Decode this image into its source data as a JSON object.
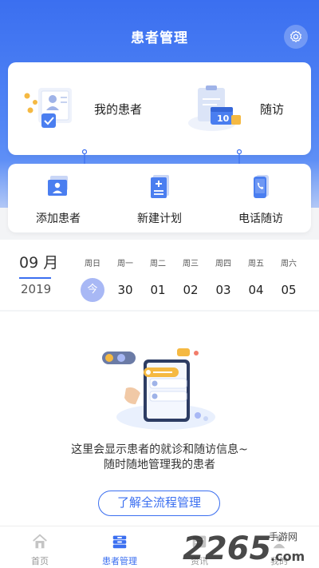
{
  "header": {
    "title": "患者管理",
    "settings_icon": "gear-icon",
    "bg_color": "#3b6ff0"
  },
  "quick_top": [
    {
      "label": "我的患者",
      "icon": "patient-card-icon"
    },
    {
      "label": "随访",
      "icon": "calendar-clipboard-icon"
    }
  ],
  "quick_bottom": [
    {
      "label": "添加患者",
      "icon": "add-patient-icon"
    },
    {
      "label": "新建计划",
      "icon": "new-plan-icon"
    },
    {
      "label": "电话随访",
      "icon": "phone-icon"
    }
  ],
  "calendar": {
    "month": "09 月",
    "year": "2019",
    "days": [
      {
        "weekday": "周日",
        "date": "今",
        "today": true
      },
      {
        "weekday": "周一",
        "date": "30"
      },
      {
        "weekday": "周二",
        "date": "01"
      },
      {
        "weekday": "周三",
        "date": "02"
      },
      {
        "weekday": "周四",
        "date": "03"
      },
      {
        "weekday": "周五",
        "date": "04"
      },
      {
        "weekday": "周六",
        "date": "05"
      }
    ]
  },
  "empty_state": {
    "line1": "这里会显示患者的就诊和随访信息~",
    "line2": "随时随地管理我的患者",
    "button": "了解全流程管理"
  },
  "tabbar": [
    {
      "label": "首页",
      "icon": "home-icon",
      "active": false
    },
    {
      "label": "患者管理",
      "icon": "patient-manage-icon",
      "active": true
    },
    {
      "label": "资讯",
      "icon": "news-icon",
      "active": false
    },
    {
      "label": "我的",
      "icon": "profile-icon",
      "active": false
    }
  ],
  "watermark": {
    "text": "2265",
    "suffix": "手游网",
    "domain": ".com"
  }
}
